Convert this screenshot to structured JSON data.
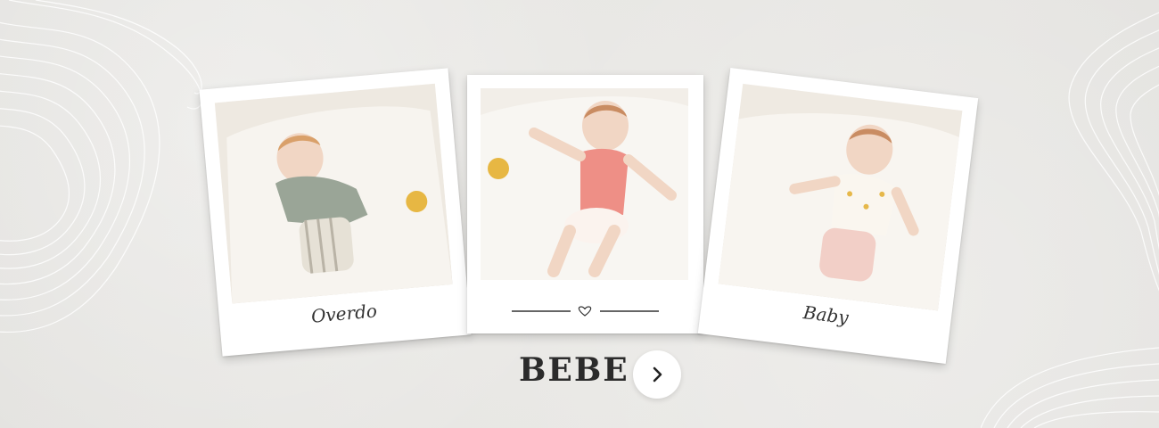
{
  "cards": [
    {
      "caption": "Overdo"
    },
    {
      "caption": ""
    },
    {
      "caption": "Baby"
    }
  ],
  "cta": {
    "title": "BEBE",
    "button_icon": "chevron-right-icon"
  },
  "colors": {
    "background": "#e9e8e5",
    "text": "#2b2b2b",
    "card": "#ffffff"
  }
}
